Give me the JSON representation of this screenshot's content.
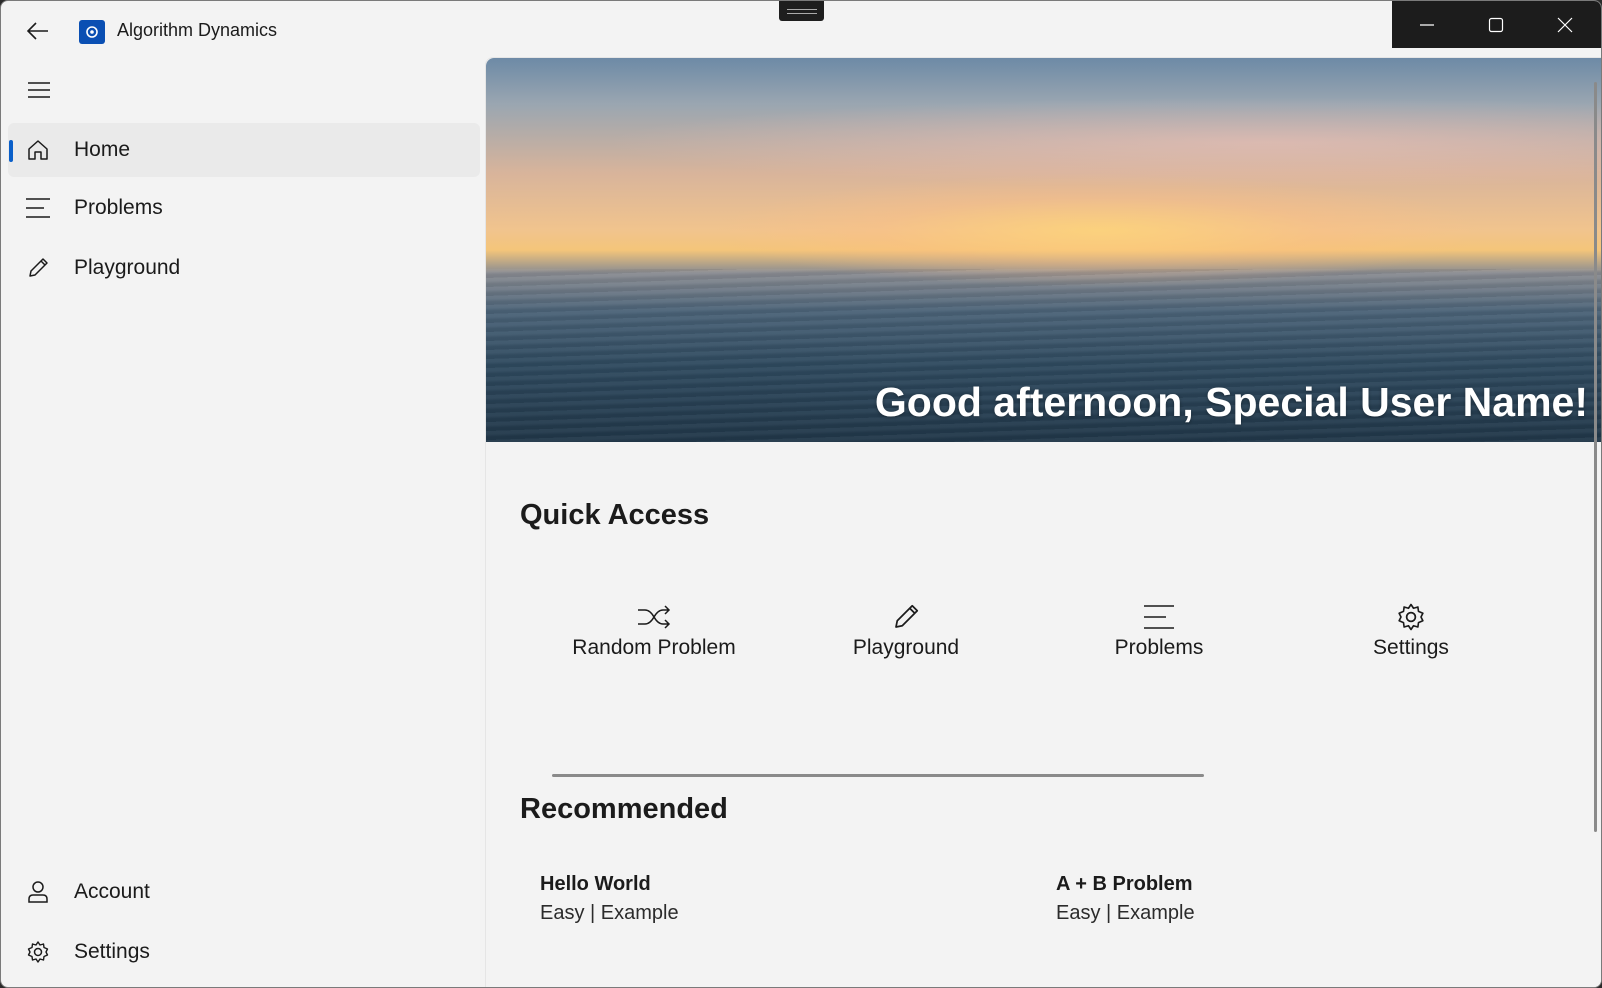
{
  "window": {
    "title": "Algorithm Dynamics"
  },
  "nav": {
    "items": [
      {
        "label": "Home",
        "icon": "home-icon",
        "selected": true
      },
      {
        "label": "Problems",
        "icon": "list-icon",
        "selected": false
      },
      {
        "label": "Playground",
        "icon": "pencil-icon",
        "selected": false
      }
    ],
    "footer_items": [
      {
        "label": "Account",
        "icon": "person-icon"
      },
      {
        "label": "Settings",
        "icon": "gear-icon"
      }
    ]
  },
  "hero": {
    "greeting": "Good afternoon, Special User Name!"
  },
  "quick_access": {
    "title": "Quick Access",
    "items": [
      {
        "label": "Random Problem",
        "icon": "shuffle-icon"
      },
      {
        "label": "Playground",
        "icon": "pencil-icon"
      },
      {
        "label": "Problems",
        "icon": "list-icon"
      },
      {
        "label": "Settings",
        "icon": "gear-icon"
      }
    ]
  },
  "recommended": {
    "title": "Recommended",
    "items": [
      {
        "name": "Hello World",
        "meta": "Easy | Example"
      },
      {
        "name": "A + B Problem",
        "meta": "Easy | Example"
      }
    ]
  },
  "colors": {
    "accent": "#0a5fc9",
    "background": "#f3f3f3",
    "caption_bar": "#1c1c1c"
  }
}
